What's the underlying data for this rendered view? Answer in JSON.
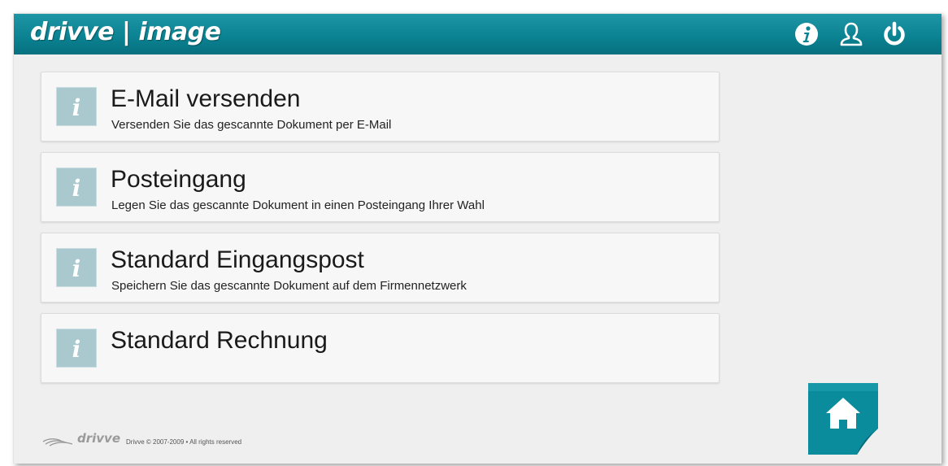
{
  "header": {
    "logo_text": "drivve | image",
    "icons": [
      "info-icon",
      "user-icon",
      "power-icon"
    ]
  },
  "menu": {
    "items": [
      {
        "title": "E-Mail versenden",
        "description": "Versenden Sie das gescannte Dokument per E-Mail",
        "icon": "info-icon"
      },
      {
        "title": "Posteingang",
        "description": "Legen Sie das gescannte Dokument in einen Posteingang Ihrer Wahl",
        "icon": "info-icon"
      },
      {
        "title": "Standard Eingangspost",
        "description": "Speichern Sie das gescannte Dokument auf dem Firmennetzwerk",
        "icon": "info-icon"
      },
      {
        "title": "Standard Rechnung",
        "description": "",
        "icon": "info-icon"
      }
    ]
  },
  "footer": {
    "brand": "drivve",
    "copyright": "Drivve © 2007-2009 • All rights reserved"
  },
  "home_button": {
    "icon": "home-icon"
  },
  "colors": {
    "header_bg": "#0b8393",
    "background": "#efefef",
    "card_bg": "#f7f7f7",
    "icon_tile": "#a9c9cf",
    "home_tile": "#0b8c9c"
  }
}
